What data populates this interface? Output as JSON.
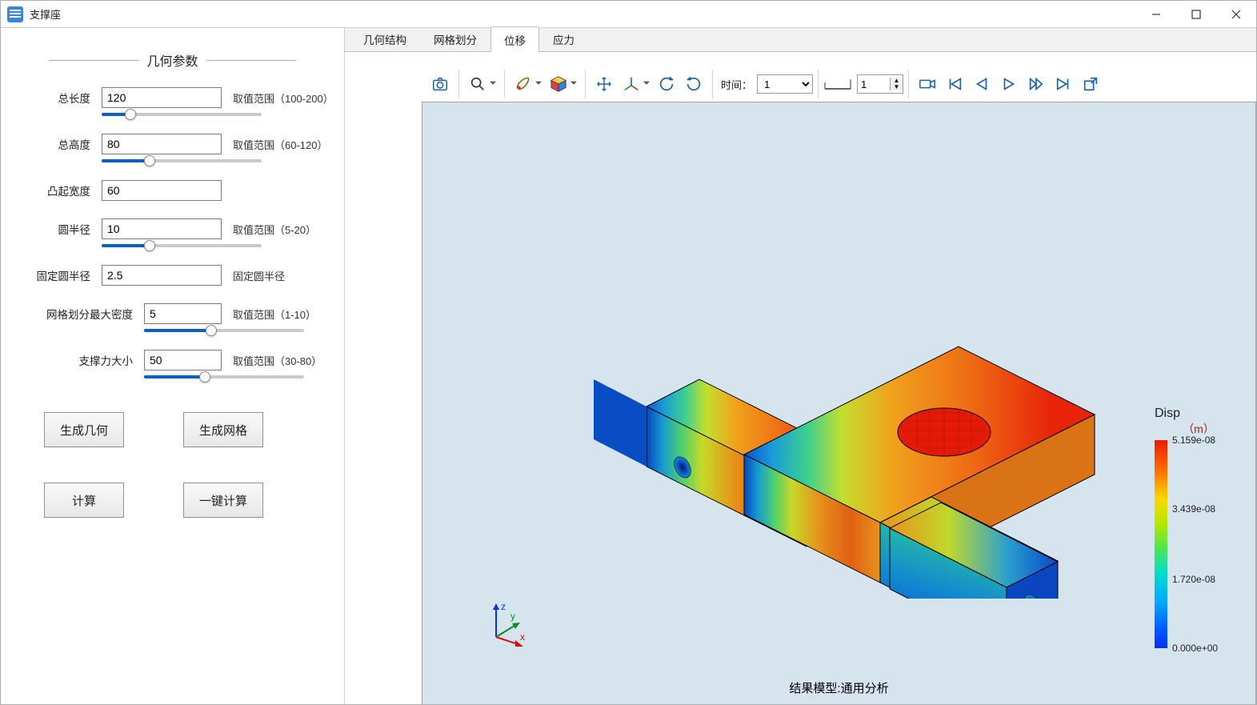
{
  "window": {
    "title": "支撑座"
  },
  "sidebar": {
    "group_title": "几何参数",
    "params": [
      {
        "label": "总长度",
        "value": "120",
        "hint": "取值范围（100-200）",
        "slider_pct": 18,
        "wide": false
      },
      {
        "label": "总高度",
        "value": "80",
        "hint": "取值范围（60-120）",
        "slider_pct": 30,
        "wide": false
      },
      {
        "label": "凸起宽度",
        "value": "60",
        "hint": "",
        "slider_pct": null,
        "wide": false
      },
      {
        "label": "圆半径",
        "value": "10",
        "hint": "取值范围（5-20）",
        "slider_pct": 30,
        "wide": false
      },
      {
        "label": "固定圆半径",
        "value": "2.5",
        "hint": "固定圆半径",
        "slider_pct": null,
        "wide": false
      },
      {
        "label": "网格划分最大密度",
        "value": "5",
        "hint": "取值范围（1-10）",
        "slider_pct": 42,
        "wide": true
      },
      {
        "label": "支撑力大小",
        "value": "50",
        "hint": "取值范围（30-80）",
        "slider_pct": 38,
        "wide": true
      }
    ],
    "buttons": [
      "生成几何",
      "生成网格",
      "计算",
      "一键计算"
    ]
  },
  "tabs": {
    "items": [
      "几何结构",
      "网格划分",
      "位移",
      "应力"
    ],
    "active_index": 2
  },
  "toolbar": {
    "icons": {
      "camera": "camera-icon",
      "zoom": "zoom-search-icon",
      "brush": "brush-palette-icon",
      "cube": "rubiks-cube-icon",
      "move": "pan-move-icon",
      "axis": "transform-axis-icon",
      "rotate_left": "rotate-left-icon",
      "rotate_right": "rotate-right-icon",
      "record": "record-icon",
      "first": "first-frame-icon",
      "prev": "prev-frame-icon",
      "play": "play-icon",
      "play_fast": "play-fast-icon",
      "last": "last-frame-icon",
      "export": "export-icon"
    },
    "time_label": "时间：",
    "time_value": "1",
    "frame_value": "1"
  },
  "viewer": {
    "caption": "结果模型:通用分析",
    "legend": {
      "title": "Disp",
      "unit": "（m）",
      "ticks": [
        {
          "label": "5.159e-08",
          "pos": 0
        },
        {
          "label": "3.439e-08",
          "pos": 33
        },
        {
          "label": "1.720e-08",
          "pos": 67
        },
        {
          "label": "0.000e+00",
          "pos": 100
        }
      ]
    },
    "triad": {
      "x": "x",
      "y": "y",
      "z": "z"
    }
  }
}
